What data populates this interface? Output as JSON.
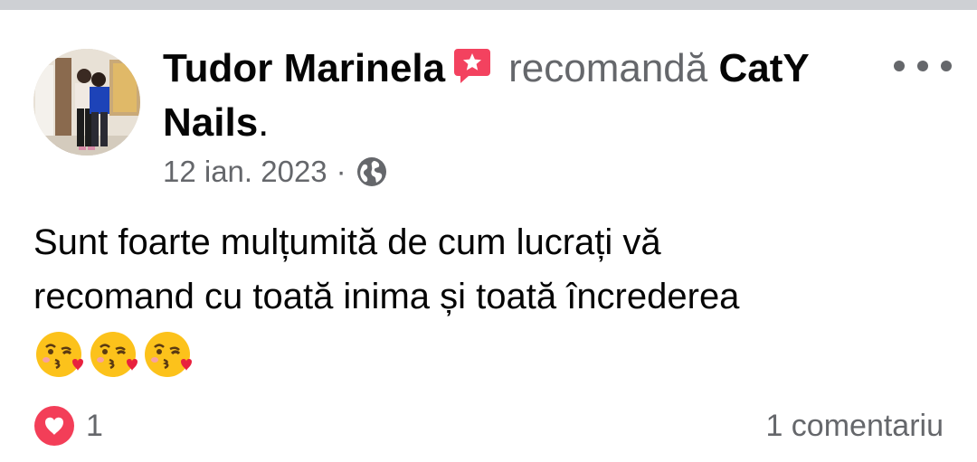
{
  "post": {
    "author": "Tudor Marinela",
    "action_text": "recomandă",
    "page_name_part1": "CatY",
    "page_name_part2": "Nails",
    "page_name_end": ".",
    "date": "12 ian. 2023",
    "separator": "·",
    "privacy_icon": "globe-icon",
    "text_line1": "Sunt foarte mulțumită de cum lucrați vă",
    "text_line2": "recomand cu toată inima  și toată încrederea",
    "emojis": [
      "kissing-heart-emoji",
      "kissing-heart-emoji",
      "kissing-heart-emoji"
    ],
    "reactions": {
      "icon": "love-reaction-icon",
      "count": "1"
    },
    "comments_label": "1 comentariu"
  },
  "colors": {
    "primary_text": "#050505",
    "secondary_text": "#65676b",
    "recommend_badge": "#f3425f",
    "love_reaction": "#f33e58",
    "top_divider": "#ced0d4"
  }
}
